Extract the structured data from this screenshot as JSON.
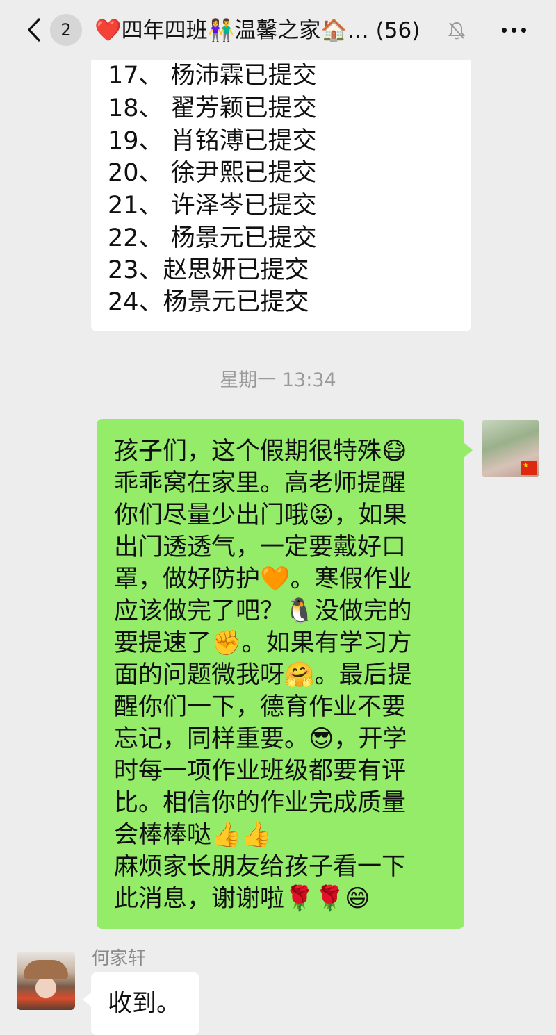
{
  "header": {
    "back_icon": "chevron-left-icon",
    "unread_count": "2",
    "title": "❤️四年四班👫温馨之家🏠… (56)",
    "mute_icon": "bell-muted-icon",
    "more_icon": "more-dots-icon"
  },
  "submission_list": [
    "17、 杨沛霖已提交",
    "18、 翟芳颖已提交",
    "19、 肖铭溥已提交",
    "20、  徐尹熙已提交",
    "21、 许泽岑已提交",
    "22、  杨景元已提交",
    "23、赵思妍已提交",
    "24、杨景元已提交"
  ],
  "timestamp": "星期一 13:34",
  "teacher_message": {
    "lines": [
      "孩子们，这个假期很特殊😷",
      "乖乖窝在家里。高老师提醒",
      "你们尽量少出门哦😝，如果",
      "出门透透气，一定要戴好口",
      "罩，做好防护🧡。寒假作业",
      "应该做完了吧？🐧没做完的",
      "要提速了✊。如果有学习方",
      "面的问题微我呀🤗。最后提",
      "醒你们一下，德育作业不要",
      "忘记，同样重要。😎，开学",
      "时每一项作业班级都要有评",
      "比。相信你的作业完成质量",
      "会棒棒哒👍👍",
      "麻烦家长朋友给孩子看一下",
      "此消息，谢谢啦🌹🌹😄"
    ]
  },
  "reply": {
    "sender": "何家轩",
    "text": "收到。"
  }
}
